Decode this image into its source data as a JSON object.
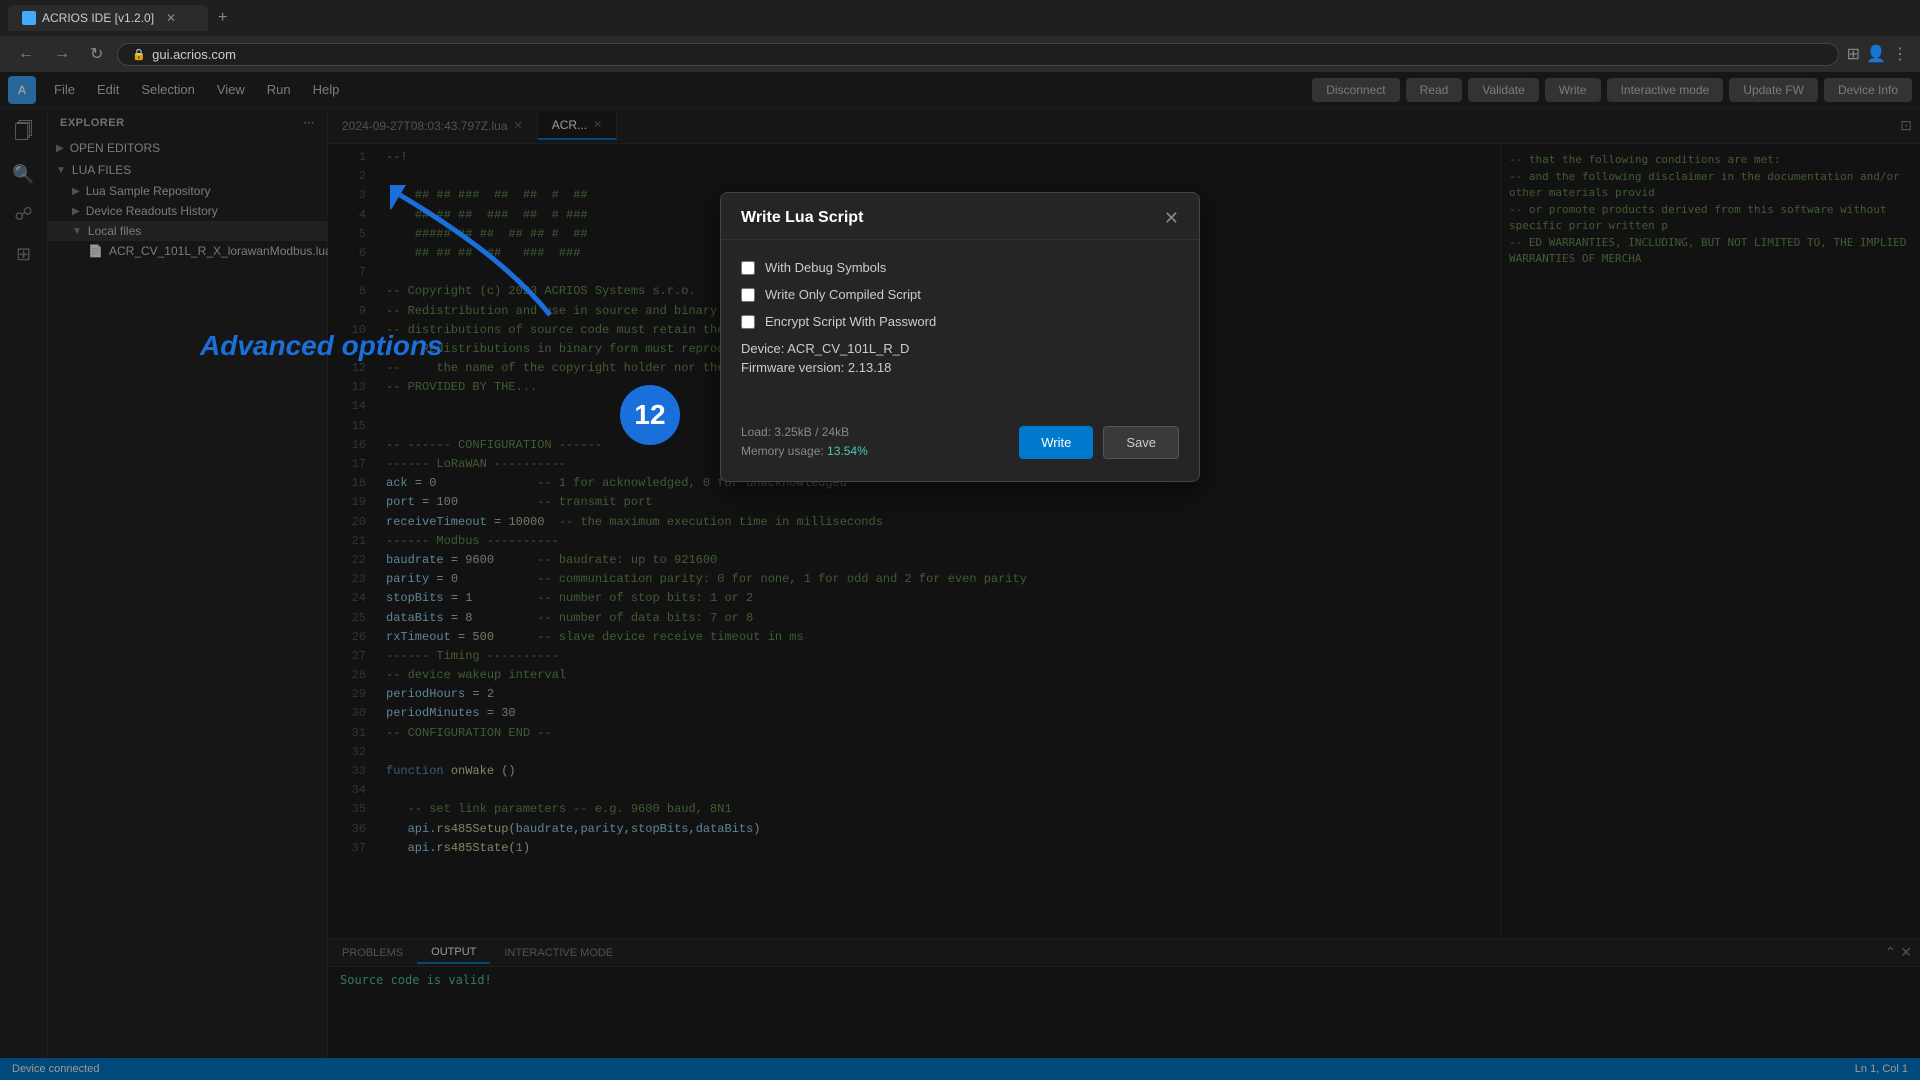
{
  "browser": {
    "tab_title": "ACRIOS IDE [v1.2.0]",
    "url": "gui.acrios.com",
    "favicon_label": "A"
  },
  "menubar": {
    "app_icon": "A",
    "items": [
      "File",
      "Edit",
      "Selection",
      "View",
      "Run",
      "Help"
    ],
    "toolbar": {
      "disconnect": "Disconnect",
      "read": "Read",
      "validate": "Validate",
      "write": "Write",
      "interactive_mode": "Interactive mode",
      "update_fw": "Update FW",
      "device_info": "Device Info"
    }
  },
  "sidebar": {
    "header": "Explorer",
    "sections": {
      "open_editors": "OPEN EDITORS",
      "lua_files": "LUA FILES",
      "subsections": [
        "Lua Sample Repository",
        "Device Readouts History",
        "Local files"
      ],
      "files": [
        "ACR_CV_101L_R_X_lorawanModbus.lua"
      ]
    }
  },
  "editor": {
    "tabs": [
      {
        "label": "2024-09-27T08:03:43.797Z.lua",
        "active": false
      },
      {
        "label": "ACR...",
        "active": true
      }
    ],
    "lines": [
      {
        "n": 1,
        "code": "--!"
      },
      {
        "n": 2,
        "code": ""
      },
      {
        "n": 3,
        "code": "    ## ## ###  ##  ##  #  ##"
      },
      {
        "n": 4,
        "code": "    ## ## ##  ###  ##  # ###"
      },
      {
        "n": 5,
        "code": "    ##### ## ##  ## ## #  ##"
      },
      {
        "n": 6,
        "code": "    ## ## ##  ##   ###  ###"
      },
      {
        "n": 7,
        "code": ""
      },
      {
        "n": 8,
        "code": "-- Copyright (c) 2023 ACRIOS Systems s.r.o."
      },
      {
        "n": 9,
        "code": "-- Redistribution and use in source..."
      },
      {
        "n": 10,
        "code": "-- distributions of source code..."
      },
      {
        "n": 11,
        "code": "--   Redistributions in binary fo..."
      },
      {
        "n": 12,
        "code": "--     the name of the copyrigh..."
      },
      {
        "n": 13,
        "code": "-- PROVIDED BY THE..."
      },
      {
        "n": 14,
        "code": ""
      },
      {
        "n": 16,
        "code": "-- ------ CONFIGURATION ------"
      },
      {
        "n": 17,
        "code": "------ LoRaWAN ----------"
      },
      {
        "n": 18,
        "code": "ack = 0              -- 1 for acknowledged, 0 for unacknowledged"
      },
      {
        "n": 19,
        "code": "port = 100           -- transmit port"
      },
      {
        "n": 20,
        "code": "receiveTimeout = 10000  -- the maximum exe...milliseconds"
      },
      {
        "n": 21,
        "code": "------ Modbus ----------"
      },
      {
        "n": 22,
        "code": "baudrate = 9600      -- baudrate: up to 9216..."
      },
      {
        "n": 23,
        "code": "parity = 0           -- communication parity: 0 for none, 1 for odd and 2 for even parity"
      },
      {
        "n": 24,
        "code": "stopBits = 1         -- number of stop bits: 1 or 2"
      },
      {
        "n": 25,
        "code": "dataBits = 8         -- number of data bits: 7 or 8"
      },
      {
        "n": 26,
        "code": "rxTimeout = 500      -- slave device receive timeout in ms"
      },
      {
        "n": 27,
        "code": "------ Timing ----------"
      },
      {
        "n": 28,
        "code": "-- device wakeup interval"
      },
      {
        "n": 29,
        "code": "periodHours = 2"
      },
      {
        "n": 30,
        "code": "periodMinutes = 30"
      },
      {
        "n": 31,
        "code": "-- CONFIGURATION END --"
      },
      {
        "n": 32,
        "code": ""
      },
      {
        "n": 33,
        "code": "function onWake ()"
      },
      {
        "n": 34,
        "code": ""
      },
      {
        "n": 35,
        "code": "   -- set link parameters -- e.g. 9600 baud, 8N1"
      },
      {
        "n": 36,
        "code": "   api.rs485Setup(baudrate,parity,stopBits,dataBits)"
      },
      {
        "n": 37,
        "code": "   api.rs485State(1)"
      }
    ]
  },
  "panel": {
    "tabs": [
      "PROBLEMS",
      "OUTPUT",
      "INTERACTIVE MODE"
    ],
    "active_tab": "OUTPUT",
    "output_text": "Source code is valid!"
  },
  "status_bar": {
    "left": "Device connected",
    "right": "Ln 1, Col 1"
  },
  "modal": {
    "title": "Write Lua Script",
    "checkboxes": [
      {
        "label": "With Debug Symbols",
        "checked": false
      },
      {
        "label": "Write Only Compiled Script",
        "checked": false
      },
      {
        "label": "Encrypt Script With Password",
        "checked": false
      }
    ],
    "device_label": "Device:",
    "device_value": "ACR_CV_101L_R_D",
    "firmware_label": "Firmware version:",
    "firmware_value": "2.13.18",
    "load_label": "Load:",
    "load_value": "3.25kB / 24kB",
    "memory_label": "Memory usage:",
    "memory_value": "13.54%",
    "btn_write": "Write",
    "btn_save": "Save",
    "advanced_options_text": "Advanced options"
  },
  "annotation": {
    "number": "12",
    "text": "Advanced options"
  }
}
